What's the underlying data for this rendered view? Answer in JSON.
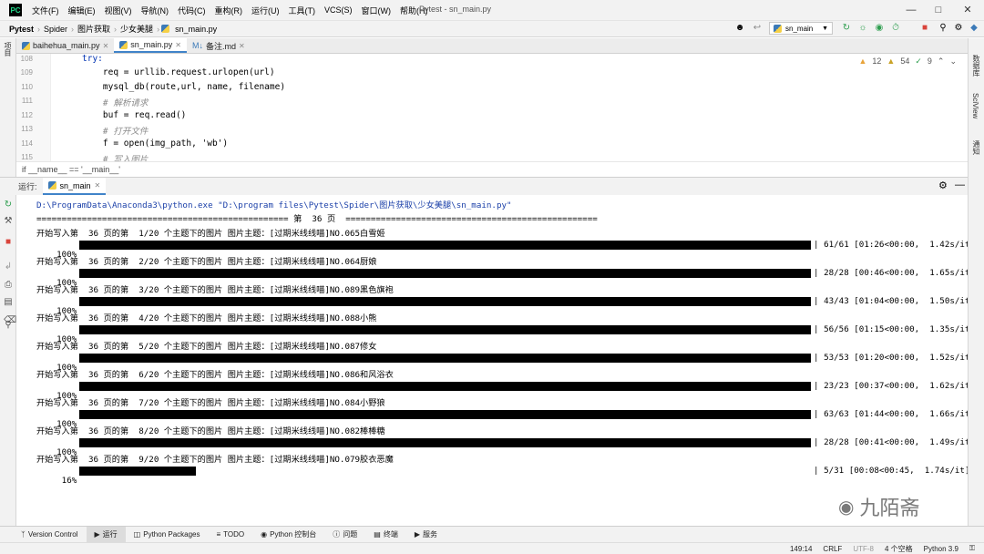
{
  "menubar": {
    "logo": "PC",
    "items": [
      "文件(F)",
      "编辑(E)",
      "视图(V)",
      "导航(N)",
      "代码(C)",
      "重构(R)",
      "运行(U)",
      "工具(T)",
      "VCS(S)",
      "窗口(W)",
      "帮助(H)"
    ],
    "title": "Pytest - sn_main.py"
  },
  "navbar": {
    "crumbs": [
      "Pytest",
      "Spider",
      "图片获取",
      "少女美腿",
      "sn_main.py"
    ],
    "run_config": "sn_main"
  },
  "tabs": [
    {
      "label": "baihehua_main.py"
    },
    {
      "label": "sn_main.py"
    },
    {
      "label": "备注.md"
    }
  ],
  "editor": {
    "line_numbers": [
      "108",
      "109",
      "110",
      "111",
      "112",
      "113",
      "114",
      "115"
    ],
    "lines": [
      "try:",
      "    req = urllib.request.urlopen(url)",
      "    mysql_db(route,url, name, filename)",
      "    # 解析请求",
      "    buf = req.read()",
      "    # 打开文件",
      "    f = open(img_path, 'wb')",
      "    # 写入图片"
    ],
    "inspection": {
      "warnings": "12",
      "weak": "54",
      "typos": "9"
    },
    "breadcrumb": "if __name__ == '__main__'"
  },
  "left_strip": {
    "project": "项目",
    "bookmarks": "书签",
    "structure": "结构"
  },
  "right_strip": {
    "database": "数据库",
    "sciview": "SciView",
    "notifications": "通知"
  },
  "run_panel": {
    "label": "运行:",
    "tab": "sn_main",
    "command": "D:\\ProgramData\\Anaconda3\\python.exe \"D:\\program files\\Pytest\\Spider\\图片获取\\少女美腿\\sn_main.py\"",
    "page_header": "================================================== 第  36 页  ==================================================",
    "entries": [
      {
        "start": "开始写入第  36 页的第  1/20 个主题下的图片 图片主题：[过期米线线喵]NO.065白雪姬",
        "percent": "100%",
        "fill": 1.0,
        "stats": "| 61/61 [01:26<00:00,  1.42s/it]"
      },
      {
        "start": "开始写入第  36 页的第  2/20 个主题下的图片 图片主题：[过期米线线喵]NO.064厨娘",
        "percent": "100%",
        "fill": 1.0,
        "stats": "| 28/28 [00:46<00:00,  1.65s/it]"
      },
      {
        "start": "开始写入第  36 页的第  3/20 个主题下的图片 图片主题：[过期米线线喵]NO.089黑色旗袍",
        "percent": "100%",
        "fill": 1.0,
        "stats": "| 43/43 [01:04<00:00,  1.50s/it]"
      },
      {
        "start": "开始写入第  36 页的第  4/20 个主题下的图片 图片主题：[过期米线线喵]NO.088小熊",
        "percent": "100%",
        "fill": 1.0,
        "stats": "| 56/56 [01:15<00:00,  1.35s/it]"
      },
      {
        "start": "开始写入第  36 页的第  5/20 个主题下的图片 图片主题：[过期米线线喵]NO.087修女",
        "percent": "100%",
        "fill": 1.0,
        "stats": "| 53/53 [01:20<00:00,  1.52s/it]"
      },
      {
        "start": "开始写入第  36 页的第  6/20 个主题下的图片 图片主题：[过期米线线喵]NO.086和风浴衣",
        "percent": "100%",
        "fill": 1.0,
        "stats": "| 23/23 [00:37<00:00,  1.62s/it]"
      },
      {
        "start": "开始写入第  36 页的第  7/20 个主题下的图片 图片主题：[过期米线线喵]NO.084小野狼",
        "percent": "100%",
        "fill": 1.0,
        "stats": "| 63/63 [01:44<00:00,  1.66s/it]"
      },
      {
        "start": "开始写入第  36 页的第  8/20 个主题下的图片 图片主题：[过期米线线喵]NO.082棒棒糖",
        "percent": "100%",
        "fill": 1.0,
        "stats": "| 28/28 [00:41<00:00,  1.49s/it]"
      },
      {
        "start": "开始写入第  36 页的第  9/20 个主题下的图片 图片主题：[过期米线线喵]NO.079胶衣恶魔",
        "percent": " 16%",
        "fill": 0.16,
        "stats": "| 5/31 [00:08<00:45,  1.74s/it]"
      }
    ]
  },
  "statusbar": {
    "items": [
      "Version Control",
      "运行",
      "Python Packages",
      "TODO",
      "Python 控制台",
      "问题",
      "终端",
      "服务"
    ]
  },
  "bottom": {
    "position": "149:14",
    "line_sep": "CRLF",
    "encoding": "UTF-8",
    "indent": "4 个空格",
    "interpreter": "Python 3.9"
  },
  "watermark": "九陌斋",
  "colors": {
    "accent": "#4083c9",
    "run_green": "#2e9e4f",
    "stop_red": "#d9443b"
  }
}
